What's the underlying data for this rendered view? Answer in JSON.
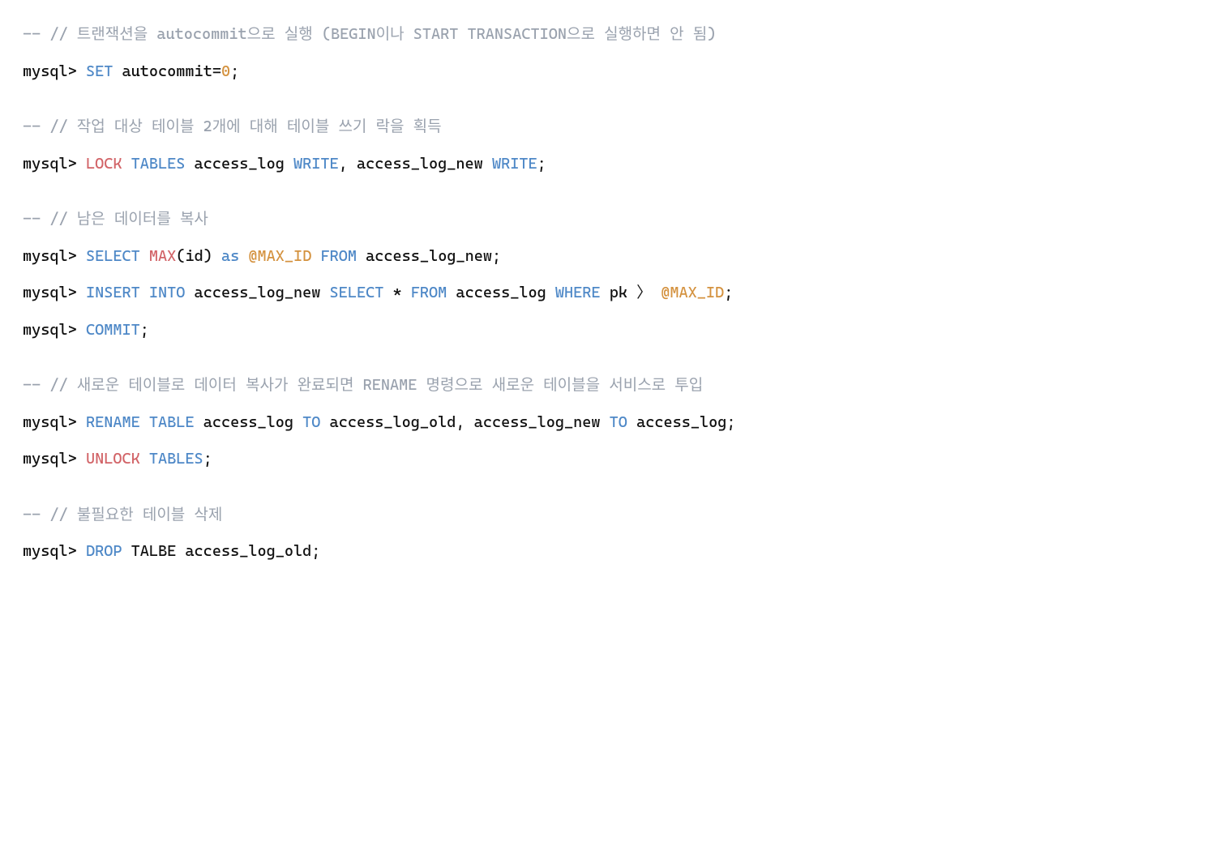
{
  "lines": [
    {
      "kind": "comment",
      "text": "-- // 트랜잭션을 autocommit으로 실행 (BEGIN이나 START TRANSACTION으로 실행하면 안 됨)"
    },
    {
      "kind": "stmt",
      "tokens": [
        {
          "c": "prompt",
          "t": "mysql"
        },
        {
          "c": "op",
          "t": ">"
        },
        {
          "c": "text",
          "t": " "
        },
        {
          "c": "kw",
          "t": "SET"
        },
        {
          "c": "text",
          "t": " autocommit"
        },
        {
          "c": "op",
          "t": "="
        },
        {
          "c": "ident-var",
          "t": "0"
        },
        {
          "c": "text",
          "t": ";"
        }
      ]
    },
    {
      "kind": "blank"
    },
    {
      "kind": "comment",
      "text": "-- // 작업 대상 테이블 2개에 대해 테이블 쓰기 락을 획득"
    },
    {
      "kind": "stmt",
      "tokens": [
        {
          "c": "prompt",
          "t": "mysql"
        },
        {
          "c": "op",
          "t": ">"
        },
        {
          "c": "text",
          "t": " "
        },
        {
          "c": "kw-red",
          "t": "LOCK"
        },
        {
          "c": "text",
          "t": " "
        },
        {
          "c": "kw",
          "t": "TABLES"
        },
        {
          "c": "text",
          "t": " access_log "
        },
        {
          "c": "kw",
          "t": "WRITE"
        },
        {
          "c": "text",
          "t": ", access_log_new "
        },
        {
          "c": "kw",
          "t": "WRITE"
        },
        {
          "c": "text",
          "t": ";"
        }
      ]
    },
    {
      "kind": "blank"
    },
    {
      "kind": "comment",
      "text": "-- // 남은 데이터를 복사"
    },
    {
      "kind": "stmt",
      "tokens": [
        {
          "c": "prompt",
          "t": "mysql"
        },
        {
          "c": "op",
          "t": ">"
        },
        {
          "c": "text",
          "t": " "
        },
        {
          "c": "kw",
          "t": "SELECT"
        },
        {
          "c": "text",
          "t": " "
        },
        {
          "c": "kw-red",
          "t": "MAX"
        },
        {
          "c": "paren",
          "t": "("
        },
        {
          "c": "text",
          "t": "id"
        },
        {
          "c": "paren",
          "t": ")"
        },
        {
          "c": "text",
          "t": " "
        },
        {
          "c": "kw",
          "t": "as"
        },
        {
          "c": "text",
          "t": " "
        },
        {
          "c": "ident-var",
          "t": "@MAX_ID"
        },
        {
          "c": "text",
          "t": " "
        },
        {
          "c": "kw",
          "t": "FROM"
        },
        {
          "c": "text",
          "t": " access_log_new;"
        }
      ]
    },
    {
      "kind": "stmt",
      "tokens": [
        {
          "c": "prompt",
          "t": "mysql"
        },
        {
          "c": "op",
          "t": ">"
        },
        {
          "c": "text",
          "t": " "
        },
        {
          "c": "kw",
          "t": "INSERT"
        },
        {
          "c": "text",
          "t": " "
        },
        {
          "c": "kw",
          "t": "INTO"
        },
        {
          "c": "text",
          "t": " access_log_new "
        },
        {
          "c": "kw",
          "t": "SELECT"
        },
        {
          "c": "text",
          "t": " "
        },
        {
          "c": "op",
          "t": "*"
        },
        {
          "c": "text",
          "t": " "
        },
        {
          "c": "kw",
          "t": "FROM"
        },
        {
          "c": "text",
          "t": " access_log "
        },
        {
          "c": "kw",
          "t": "WHERE"
        },
        {
          "c": "text",
          "t": " pk "
        },
        {
          "c": "op-gt",
          "t": "〉"
        },
        {
          "c": "text",
          "t": " "
        },
        {
          "c": "ident-var",
          "t": "@MAX_ID"
        },
        {
          "c": "text",
          "t": ";"
        }
      ]
    },
    {
      "kind": "stmt",
      "tokens": [
        {
          "c": "prompt",
          "t": "mysql"
        },
        {
          "c": "op",
          "t": ">"
        },
        {
          "c": "text",
          "t": " "
        },
        {
          "c": "kw",
          "t": "COMMIT"
        },
        {
          "c": "text",
          "t": ";"
        }
      ]
    },
    {
      "kind": "blank"
    },
    {
      "kind": "comment",
      "text": "-- // 새로운 테이블로 데이터 복사가 완료되면 RENAME 명령으로 새로운 테이블을 서비스로 투입"
    },
    {
      "kind": "stmt",
      "tokens": [
        {
          "c": "prompt",
          "t": "mysql"
        },
        {
          "c": "op",
          "t": ">"
        },
        {
          "c": "text",
          "t": " "
        },
        {
          "c": "kw",
          "t": "RENAME"
        },
        {
          "c": "text",
          "t": " "
        },
        {
          "c": "kw",
          "t": "TABLE"
        },
        {
          "c": "text",
          "t": " access_log "
        },
        {
          "c": "kw",
          "t": "TO"
        },
        {
          "c": "text",
          "t": " access_log_old, access_log_new "
        },
        {
          "c": "kw",
          "t": "TO"
        },
        {
          "c": "text",
          "t": " access_log;"
        }
      ]
    },
    {
      "kind": "stmt",
      "tokens": [
        {
          "c": "prompt",
          "t": "mysql"
        },
        {
          "c": "op",
          "t": ">"
        },
        {
          "c": "text",
          "t": " "
        },
        {
          "c": "kw-red",
          "t": "UNLOCK"
        },
        {
          "c": "text",
          "t": " "
        },
        {
          "c": "kw",
          "t": "TABLES"
        },
        {
          "c": "text",
          "t": ";"
        }
      ]
    },
    {
      "kind": "blank"
    },
    {
      "kind": "comment",
      "text": "-- // 불필요한 테이블 삭제"
    },
    {
      "kind": "stmt",
      "tokens": [
        {
          "c": "prompt",
          "t": "mysql"
        },
        {
          "c": "op",
          "t": ">"
        },
        {
          "c": "text",
          "t": " "
        },
        {
          "c": "kw",
          "t": "DROP"
        },
        {
          "c": "text",
          "t": " TALBE access_log_old;"
        }
      ]
    }
  ]
}
